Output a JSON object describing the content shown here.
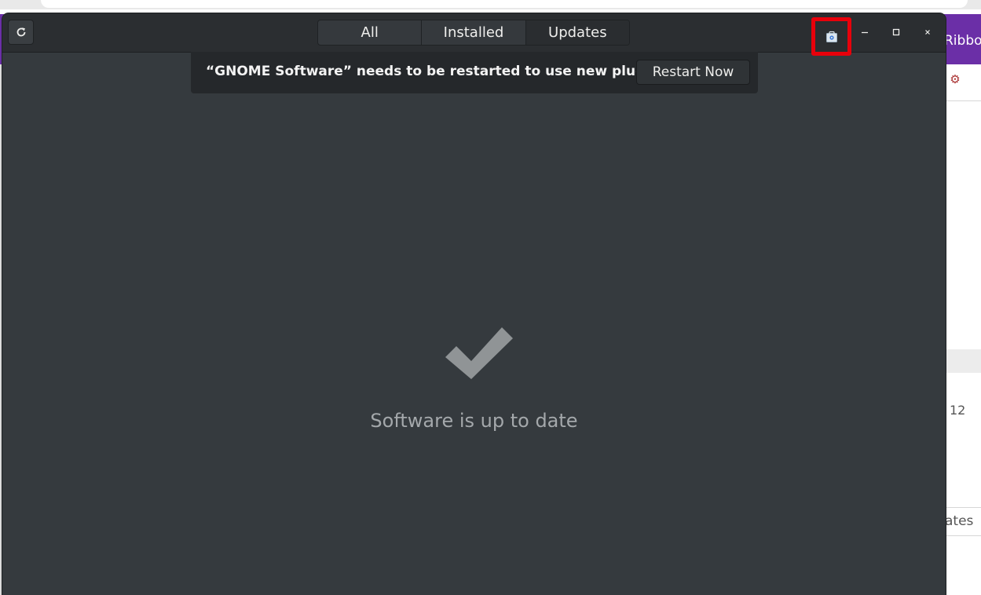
{
  "background": {
    "ribbon_text": "Ribbo",
    "side_number": "12",
    "side_text": "ates"
  },
  "window": {
    "tabs": [
      {
        "label": "All",
        "active": false
      },
      {
        "label": "Installed",
        "active": false
      },
      {
        "label": "Updates",
        "active": true
      }
    ],
    "notification": {
      "message": "“GNOME Software” needs to be restarted to use new plugins.",
      "button": "Restart Now"
    },
    "status_text": "Software is up to date",
    "icons": {
      "refresh": "refresh-icon",
      "menu": "app-menu-icon",
      "minimize": "minimize-icon",
      "maximize": "maximize-icon",
      "close": "close-icon",
      "status": "checkmark-icon"
    }
  },
  "colors": {
    "window_bg": "#353a3e",
    "headerbar_bg": "#2b2e31",
    "highlight_box": "#e8000b",
    "ribbon": "#6b2fa7"
  }
}
